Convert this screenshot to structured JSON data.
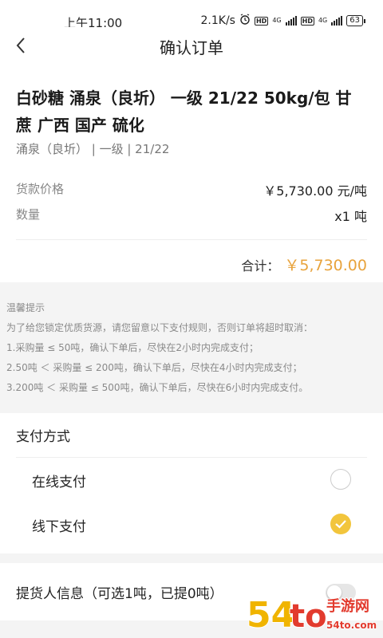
{
  "status_bar": {
    "time": "上午11:00",
    "network_speed": "2.1K/s",
    "hd_label": "HD",
    "network_type": "4G",
    "battery": "63"
  },
  "nav": {
    "title": "确认订单"
  },
  "product": {
    "name": "白砂糖 涌泉（良圻） 一级 21/22 50kg/包 甘蔗 广西 国产 硫化",
    "spec": "涌泉（良圻） | 一级 | 21/22",
    "price_label": "货款价格",
    "price_value": "￥5,730.00 元/吨",
    "quantity_label": "数量",
    "quantity_value": "x1 吨",
    "total_label": "合计：",
    "total_value": "￥5,730.00"
  },
  "notice": {
    "title": "温馨提示",
    "lines": [
      "为了给您锁定优质货源，请您留意以下支付规则，否则订单将超时取消：",
      "1.采购量 ≤ 50吨，确认下单后，尽快在2小时内完成支付；",
      "2.50吨 ＜ 采购量 ≤ 200吨，确认下单后，尽快在4小时内完成支付；",
      "3.200吨 ＜ 采购量 ≤ 500吨，确认下单后，尽快在6小时内完成支付。"
    ]
  },
  "payment": {
    "title": "支付方式",
    "options": [
      {
        "label": "在线支付",
        "selected": false
      },
      {
        "label": "线下支付",
        "selected": true
      }
    ]
  },
  "pickup": {
    "label": "提货人信息（可选1吨，已提0吨）",
    "enabled": false
  },
  "watermark": {
    "brand": "54to手游网",
    "url": "54to.com"
  },
  "colors": {
    "accent": "#f2c53c",
    "price": "#e8a33c"
  }
}
